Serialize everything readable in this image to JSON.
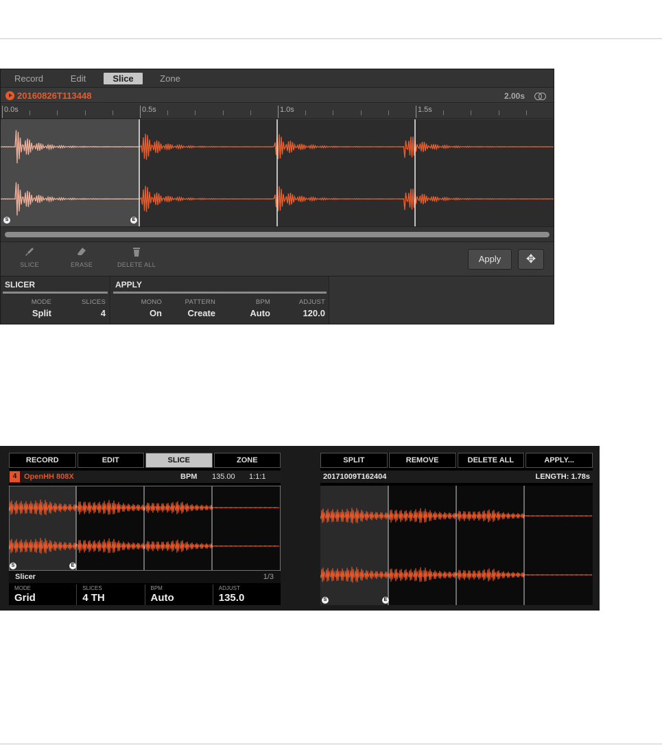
{
  "software": {
    "tabs": [
      {
        "label": "Record",
        "active": false
      },
      {
        "label": "Edit",
        "active": false
      },
      {
        "label": "Slice",
        "active": true
      },
      {
        "label": "Zone",
        "active": false
      }
    ],
    "sample_name": "20160826T113448",
    "length": "2.00s",
    "ruler_labels": [
      "0.0s",
      "0.5s",
      "1.0s",
      "1.5s"
    ],
    "slice_markers": {
      "start": "S",
      "end": "E"
    },
    "tools": [
      {
        "label": "SLICE",
        "icon": "brush-icon"
      },
      {
        "label": "ERASE",
        "icon": "eraser-icon"
      },
      {
        "label": "DELETE ALL",
        "icon": "trash-icon"
      }
    ],
    "apply_label": "Apply",
    "slicer_group": {
      "title": "SLICER",
      "params": [
        {
          "label": "MODE",
          "value": "Split"
        },
        {
          "label": "SLICES",
          "value": "4"
        }
      ]
    },
    "apply_group": {
      "title": "APPLY",
      "params": [
        {
          "label": "MONO",
          "value": "On"
        },
        {
          "label": "PATTERN",
          "value": "Create"
        },
        {
          "label": "BPM",
          "value": "Auto"
        },
        {
          "label": "ADJUST",
          "value": "120.0"
        }
      ]
    },
    "accent_color": "#e85a2a"
  },
  "hardware_left": {
    "tabs": [
      {
        "label": "RECORD",
        "active": false
      },
      {
        "label": "EDIT",
        "active": false
      },
      {
        "label": "SLICE",
        "active": true
      },
      {
        "label": "ZONE",
        "active": false
      }
    ],
    "pad_number": "4",
    "sample_name": "OpenHH 808X",
    "bpm_label": "BPM",
    "bpm_value": "135.00",
    "position": "1:1:1",
    "markers": {
      "start": "S",
      "end": "E"
    },
    "status_label": "Slicer",
    "status_page": "1/3",
    "params": [
      {
        "label": "MODE",
        "value": "Grid"
      },
      {
        "label": "SLICES",
        "value": "4 TH"
      },
      {
        "label": "BPM",
        "value": "Auto"
      },
      {
        "label": "ADJUST",
        "value": "135.0"
      }
    ]
  },
  "hardware_right": {
    "buttons": [
      {
        "label": "SPLIT"
      },
      {
        "label": "REMOVE"
      },
      {
        "label": "DELETE ALL"
      },
      {
        "label": "APPLY..."
      }
    ],
    "sample_name": "20171009T162404",
    "length": "LENGTH: 1.78s",
    "markers": {
      "start": "S",
      "end": "E"
    }
  }
}
